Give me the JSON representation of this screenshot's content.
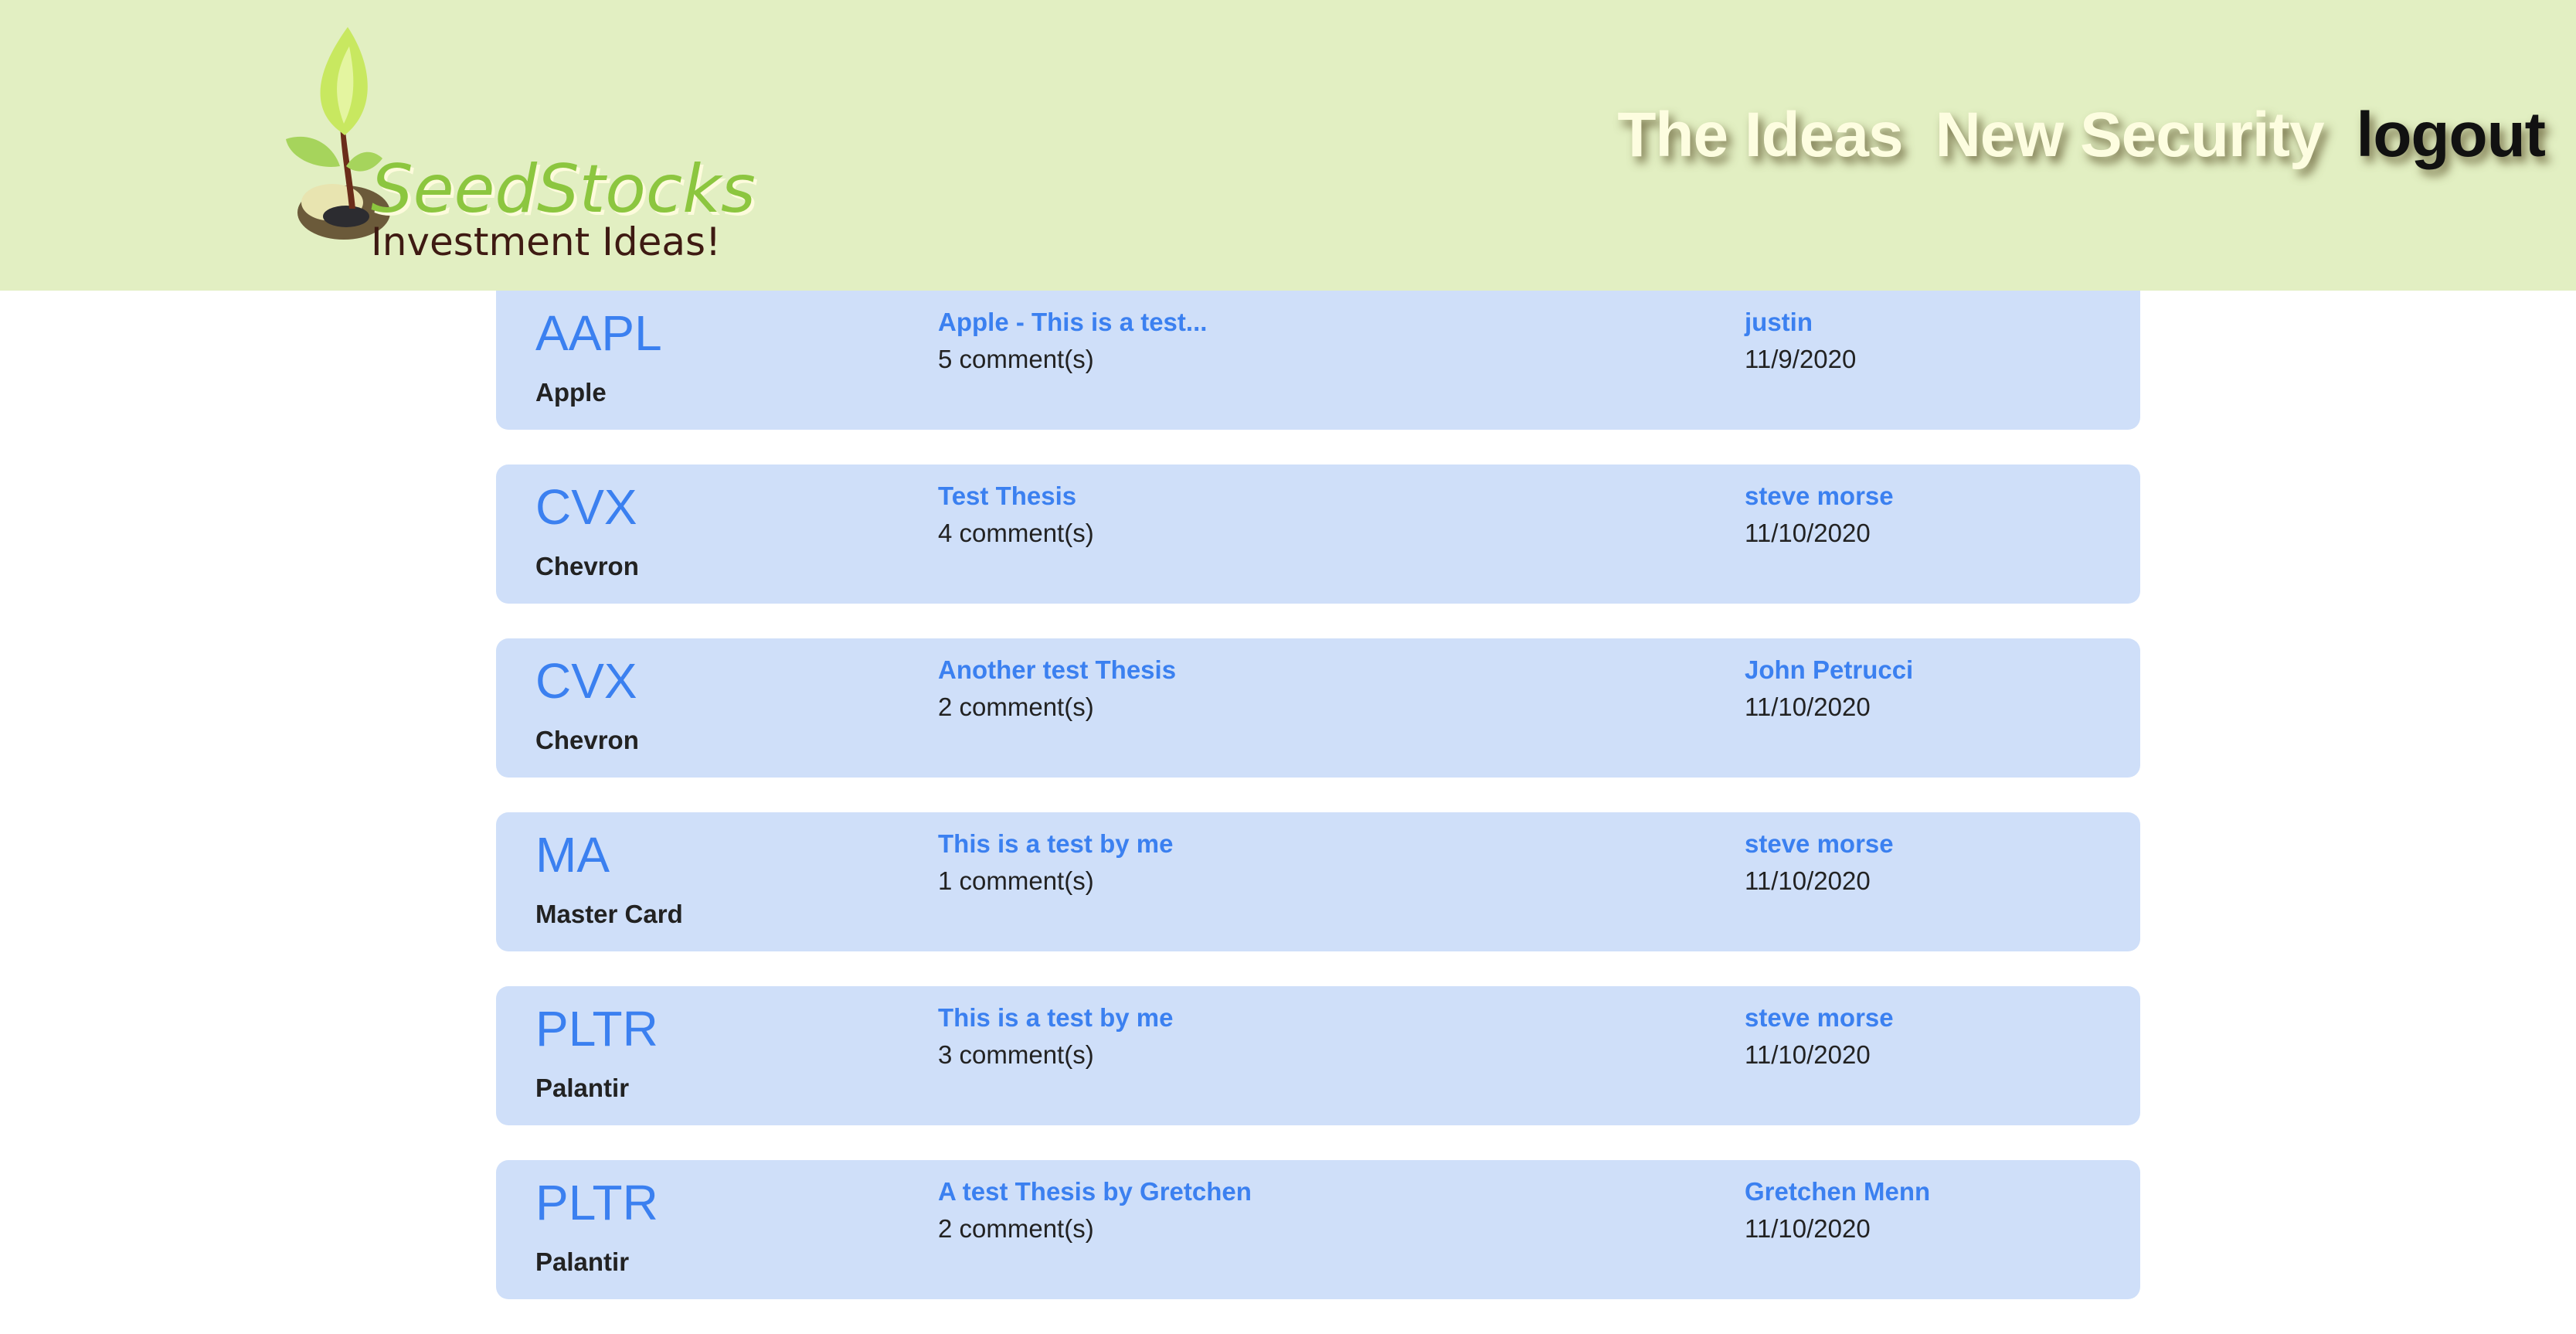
{
  "header": {
    "logo": {
      "name": "SeedStocks",
      "tagline": "Investment Ideas!"
    },
    "nav": [
      {
        "label": "The Ideas"
      },
      {
        "label": "New Security"
      },
      {
        "label": "logout"
      }
    ]
  },
  "colors": {
    "header_bg": "#e2efc2",
    "card_bg": "#cfdff9",
    "accent": "#3b80f0"
  },
  "ideas": [
    {
      "ticker": "AAPL",
      "company": "Apple",
      "title": "Apple - This is a test...",
      "comments": "5 comment(s)",
      "author": "justin",
      "date": "11/9/2020"
    },
    {
      "ticker": "CVX",
      "company": "Chevron",
      "title": "Test Thesis",
      "comments": "4 comment(s)",
      "author": "steve morse",
      "date": "11/10/2020"
    },
    {
      "ticker": "CVX",
      "company": "Chevron",
      "title": "Another test Thesis",
      "comments": "2 comment(s)",
      "author": "John Petrucci",
      "date": "11/10/2020"
    },
    {
      "ticker": "MA",
      "company": "Master Card",
      "title": "This is a test by me",
      "comments": "1 comment(s)",
      "author": "steve morse",
      "date": "11/10/2020"
    },
    {
      "ticker": "PLTR",
      "company": "Palantir",
      "title": "This is a test by me",
      "comments": "3 comment(s)",
      "author": "steve morse",
      "date": "11/10/2020"
    },
    {
      "ticker": "PLTR",
      "company": "Palantir",
      "title": "A test Thesis by Gretchen",
      "comments": "2 comment(s)",
      "author": "Gretchen Menn",
      "date": "11/10/2020"
    }
  ]
}
